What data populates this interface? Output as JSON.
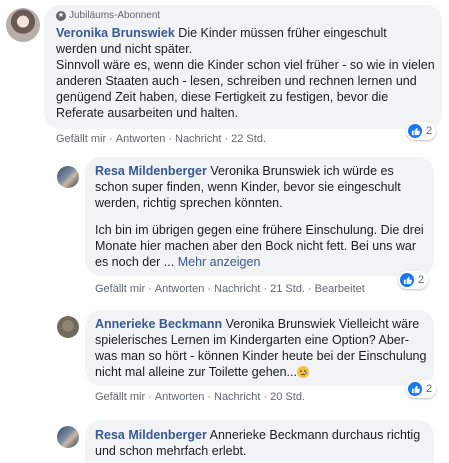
{
  "comments": [
    {
      "badge": "Jubiläums-Abonnent",
      "author": "Veronika Brunswiek",
      "text_line1": " Die Kinder müssen früher eingeschult",
      "text_rest": "werden und nicht später.\nSinnvoll wäre es, wenn die Kinder schon viel früher - so wie in vielen anderen Staaten auch - lesen, schreiben und rechnen lernen und genügend Zeit haben, diese Fertigkeit zu festigen, bevor die Referate ausarbeiten und halten.",
      "actions": [
        "Gefällt mir",
        "Antworten",
        "Nachricht",
        "22 Std."
      ],
      "reactions": "2"
    },
    {
      "author": "Resa Mildenberger",
      "text": " Veronika Brunswiek ich würde es schon super finden, wenn Kinder, bevor sie eingeschult werden, richtig sprechen könnten.",
      "text2": "Ich bin im übrigen gegen eine frühere Einschulung. Die drei Monate hier machen aber den Bock nicht fett. Bei uns war es noch der ...",
      "more": "Mehr anzeigen",
      "actions": [
        "Gefällt mir",
        "Antworten",
        "Nachricht",
        "21 Std.",
        "Bearbeitet"
      ],
      "reactions": "2"
    },
    {
      "author": "Annerieke Beckmann",
      "text": " Veronika Brunswiek Vielleicht wäre spielerisches Lernen im Kindergarten eine Option? Aber- was man so hört - können Kinder heute bei der Einschulung nicht mal alleine zur Toilette gehen...",
      "emoji": "face-with-tear-emoji",
      "actions": [
        "Gefällt mir",
        "Antworten",
        "Nachricht",
        "20 Std."
      ],
      "reactions": "2"
    },
    {
      "author": "Resa Mildenberger",
      "text": " Annerieke Beckmann durchaus richtig und schon mehrfach erlebt."
    }
  ],
  "colors": {
    "link": "#385898",
    "bubble": "#f2f3f5",
    "like": "#1877f2",
    "meta": "#606770"
  }
}
